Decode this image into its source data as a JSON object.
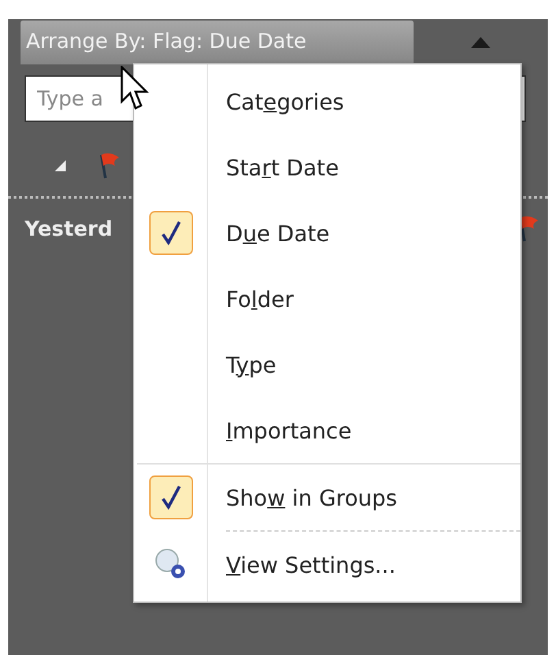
{
  "header": {
    "label": "Arrange By: Flag: Due Date"
  },
  "search": {
    "placeholder": "Type a"
  },
  "group_row": {
    "label": "Yesterd"
  },
  "menu": {
    "items": [
      {
        "label": {
          "before": "Cat",
          "access_key": "e",
          "after": "gories"
        },
        "checked": false,
        "kind": "option"
      },
      {
        "label": {
          "before": "Sta",
          "access_key": "r",
          "after": "t Date"
        },
        "checked": false,
        "kind": "option"
      },
      {
        "label": {
          "before": "D",
          "access_key": "u",
          "after": "e Date"
        },
        "checked": true,
        "kind": "option"
      },
      {
        "label": {
          "before": "Fo",
          "access_key": "l",
          "after": "der"
        },
        "checked": false,
        "kind": "option"
      },
      {
        "label": {
          "before": "T",
          "access_key": "y",
          "after": "pe"
        },
        "checked": false,
        "kind": "option"
      },
      {
        "label": {
          "access_key": "I",
          "after": "mportance"
        },
        "checked": false,
        "kind": "option"
      },
      {
        "label": {
          "before": "Sho",
          "access_key": "w",
          "after": " in Groups"
        },
        "checked": true,
        "kind": "toggle"
      },
      {
        "label": {
          "access_key": "V",
          "after": "iew Settings..."
        },
        "kind": "settings"
      }
    ]
  }
}
